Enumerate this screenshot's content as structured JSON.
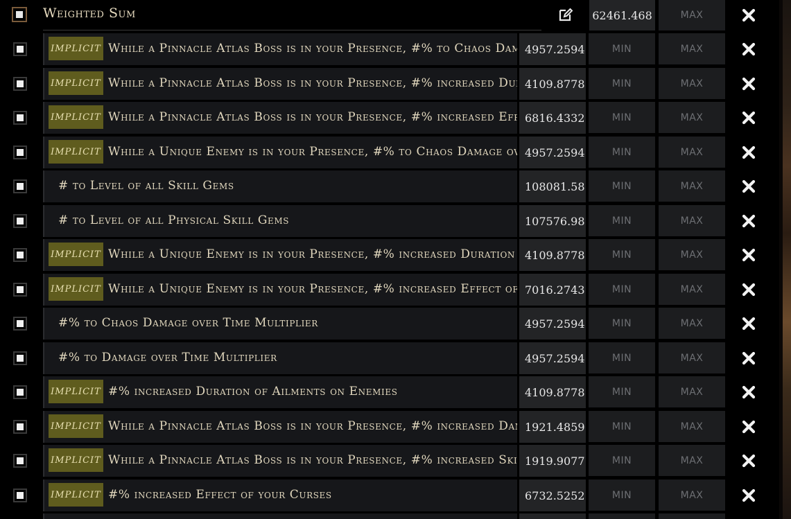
{
  "header": {
    "title": "Weighted Sum",
    "value": "62461.468",
    "max_label": "MAX"
  },
  "labels": {
    "implicit": "IMPLICIT",
    "min": "MIN",
    "max": "MAX"
  },
  "colors": {
    "implicit_badge": "#5f5c1e",
    "panel": "#16171a",
    "value_bg": "#232426"
  },
  "rows": [
    {
      "implicit": true,
      "text": "While a Pinnacle Atlas Boss is in your Presence, #% to Chaos Damage over Time Multiplier",
      "value": "4957.2594"
    },
    {
      "implicit": true,
      "text": "While a Pinnacle Atlas Boss is in your Presence, #% increased Duration of Ailments on Enemies",
      "value": "4109.8778"
    },
    {
      "implicit": true,
      "text": "While a Pinnacle Atlas Boss is in your Presence, #% increased Effect of your Curses",
      "value": "6816.4332"
    },
    {
      "implicit": true,
      "text": "While a Unique Enemy is in your Presence, #% to Chaos Damage over Time Multiplier",
      "value": "4957.2594"
    },
    {
      "implicit": false,
      "text": "# to Level of all Skill Gems",
      "value": "108081.58"
    },
    {
      "implicit": false,
      "text": "# to Level of all Physical Skill Gems",
      "value": "107576.98"
    },
    {
      "implicit": true,
      "text": "While a Unique Enemy is in your Presence, #% increased Duration of Ailments on Enemies",
      "value": "4109.8778"
    },
    {
      "implicit": true,
      "text": "While a Unique Enemy is in your Presence, #% increased Effect of your Curses",
      "value": "7016.2743"
    },
    {
      "implicit": false,
      "text": "#% to Chaos Damage over Time Multiplier",
      "value": "4957.2594"
    },
    {
      "implicit": false,
      "text": "#% to Damage over Time Multiplier",
      "value": "4957.2594"
    },
    {
      "implicit": true,
      "text": "#% increased Duration of Ailments on Enemies",
      "value": "4109.8778"
    },
    {
      "implicit": true,
      "text": "While a Pinnacle Atlas Boss is in your Presence, #% increased Damage",
      "value": "1921.4859"
    },
    {
      "implicit": true,
      "text": "While a Pinnacle Atlas Boss is in your Presence, #% increased Skill Speed",
      "value": "1919.9077"
    },
    {
      "implicit": true,
      "text": "#% increased Effect of your Curses",
      "value": "6732.5252"
    }
  ]
}
